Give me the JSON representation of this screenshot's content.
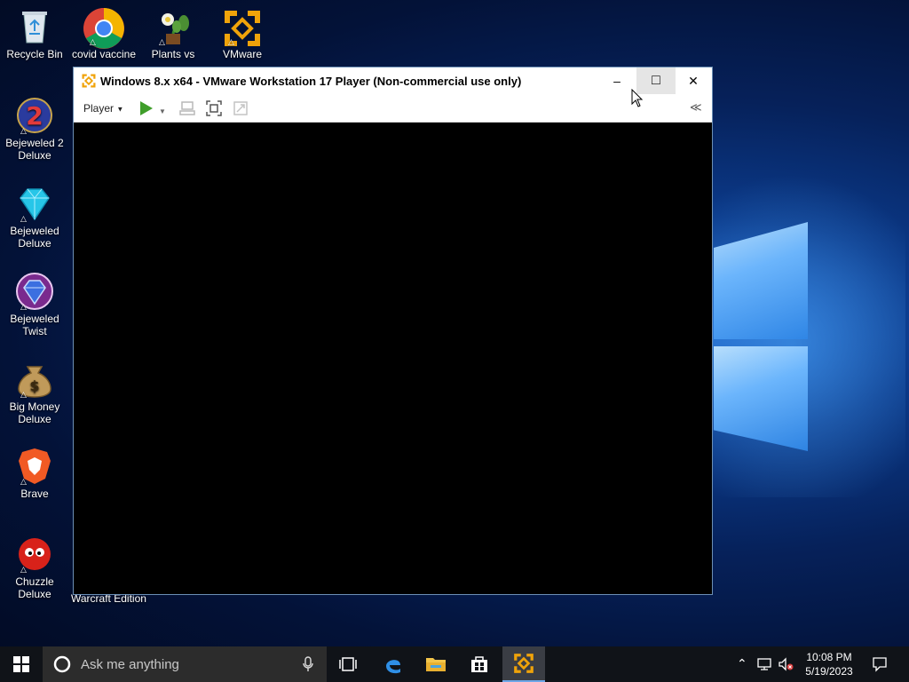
{
  "desktop": {
    "icons": [
      {
        "label": "Recycle Bin",
        "icon": "recycle-bin-icon"
      },
      {
        "label": "covid vaccine",
        "icon": "chrome-icon"
      },
      {
        "label": "Plants vs",
        "icon": "plants-vs-zombies-icon"
      },
      {
        "label": "VMware",
        "icon": "vmware-icon"
      },
      {
        "label": "Bejeweled 2 Deluxe",
        "line1": "Bejeweled 2",
        "line2": "Deluxe",
        "icon": "bejeweled-2-icon"
      },
      {
        "label": "Bejeweled Deluxe",
        "line1": "Bejeweled",
        "line2": "Deluxe",
        "icon": "bejeweled-deluxe-icon"
      },
      {
        "label": "Bejeweled Twist",
        "line1": "Bejeweled",
        "line2": "Twist",
        "icon": "bejeweled-twist-icon"
      },
      {
        "label": "Big Money Deluxe",
        "line1": "Big Money",
        "line2": "Deluxe",
        "icon": "big-money-icon"
      },
      {
        "label": "Brave",
        "icon": "brave-icon"
      },
      {
        "label": "Chuzzle Deluxe",
        "icon": "chuzzle-icon"
      }
    ],
    "partial_label": "Warcraft Edition"
  },
  "window": {
    "title": "Windows 8.x x64 - VMware Workstation 17 Player (Non-commercial use only)",
    "minimize": "–",
    "maximize": "□",
    "close": "✕",
    "toolbar": {
      "player_menu": "Player",
      "collapse": "≪"
    }
  },
  "taskbar": {
    "search_placeholder": "Ask me anything",
    "time": "10:08 PM",
    "date": "5/19/2023",
    "apps": [
      "task-view-icon",
      "edge-icon",
      "file-explorer-icon",
      "store-icon",
      "vmware-icon"
    ]
  },
  "colors": {
    "accent": "#6ea6e8",
    "chrome_red": "#db4437",
    "chrome_yellow": "#f4b400",
    "chrome_green": "#0f9d58",
    "chrome_blue": "#4285f4",
    "vmware_orange": "#f0a30a",
    "play_green": "#3f9e2a"
  }
}
